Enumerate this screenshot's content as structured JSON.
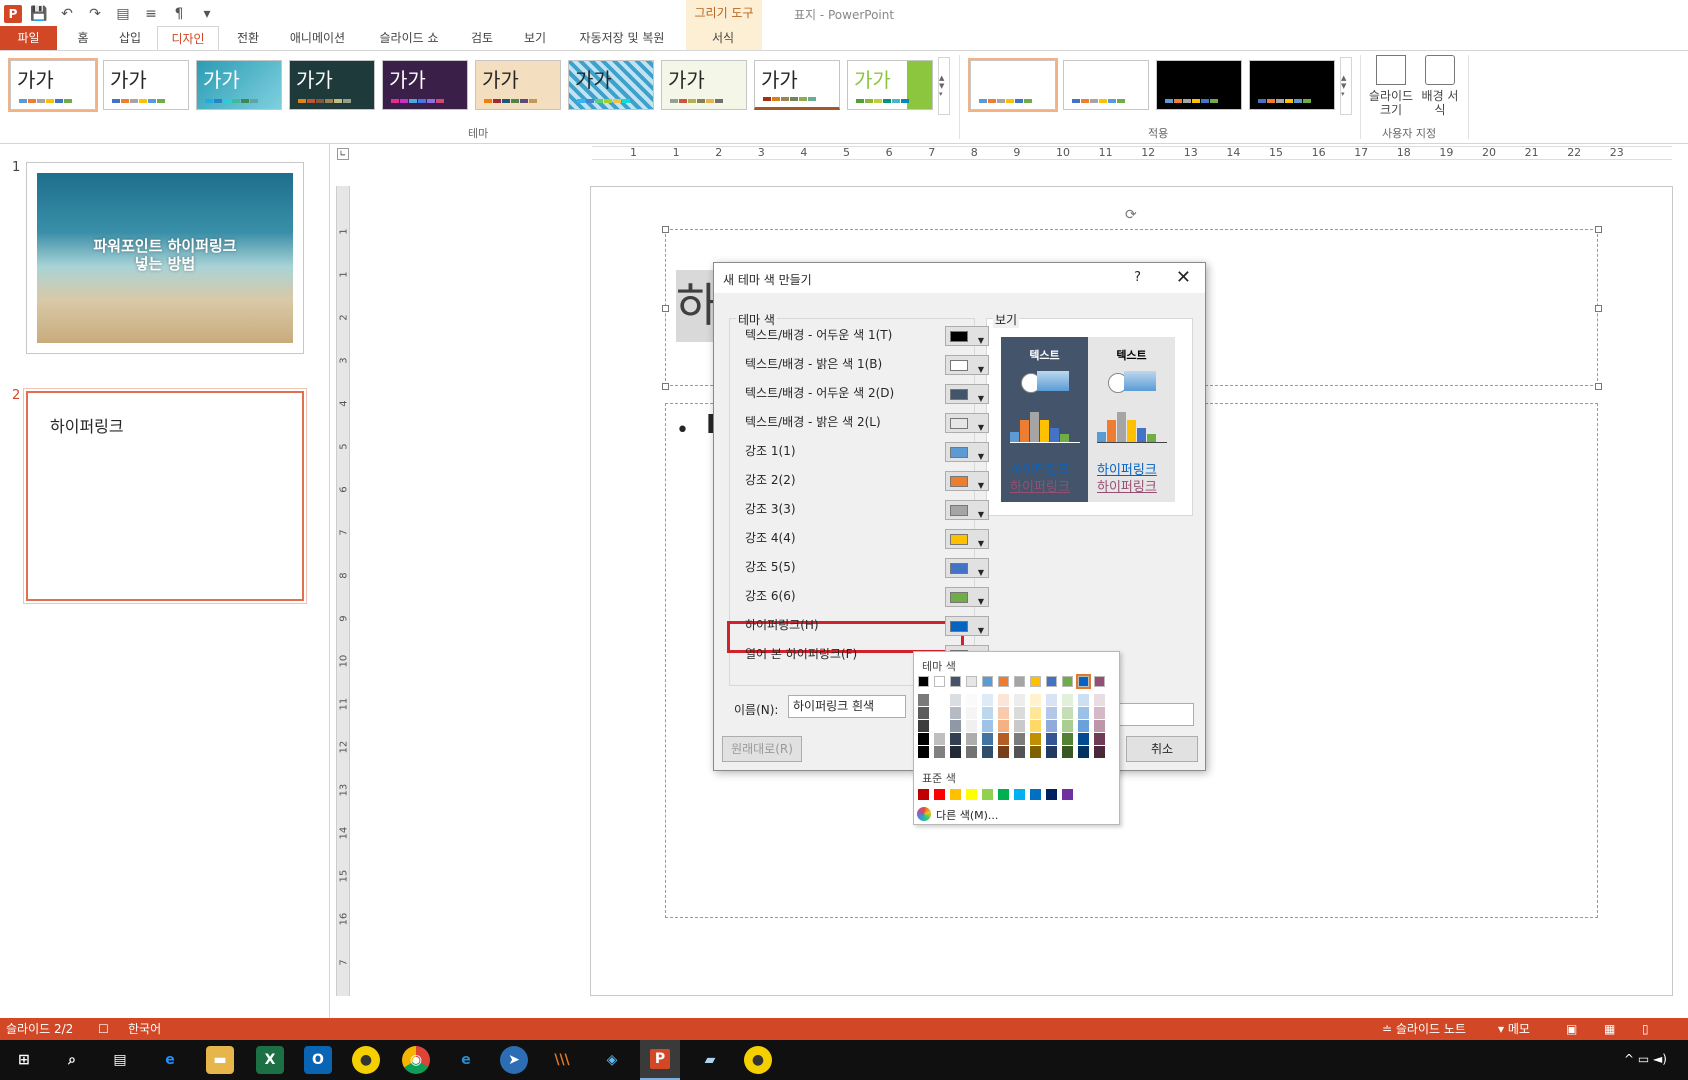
{
  "app": {
    "title": "표지 - PowerPoint",
    "contextual_group": "그리기 도구"
  },
  "qat": {
    "icons": [
      "powerpoint-logo",
      "save-icon",
      "undo-icon",
      "redo-icon",
      "start-from-beginning-icon",
      "align-icon",
      "paragraph-icon",
      "customize-qat-icon"
    ],
    "logo_letter": "P"
  },
  "tabs": [
    "파일",
    "홈",
    "삽입",
    "디자인",
    "전환",
    "애니메이션",
    "슬라이드 쇼",
    "검토",
    "보기",
    "자동저장 및 복원",
    "서식"
  ],
  "active_tab": "디자인",
  "ribbon": {
    "theme_sample_text": "가가",
    "themes_group_label": "테마",
    "variants_group_label": "적용",
    "customize_group_label": "사용자 지정",
    "slide_size_label": "슬라이드 크기",
    "background_label": "배경 서식"
  },
  "ruler": {
    "h_ticks": [
      "1",
      "1",
      "2",
      "3",
      "4",
      "5",
      "6",
      "7",
      "8",
      "9",
      "10",
      "11",
      "12",
      "13",
      "14",
      "15",
      "16",
      "17",
      "18",
      "19",
      "20",
      "21",
      "22",
      "23"
    ],
    "v_ticks": [
      "1",
      "1",
      "2",
      "3",
      "4",
      "5",
      "6",
      "7",
      "8",
      "9",
      "10",
      "11",
      "12",
      "13",
      "14",
      "15",
      "16",
      "7"
    ]
  },
  "slides_pane": {
    "slide1_number": "1",
    "slide1_title": "파워포인트 하이퍼링크\n넣는 방법",
    "slide2_number": "2",
    "slide2_title": "하이퍼링크"
  },
  "slide_canvas": {
    "title_glyph": "하",
    "bullet_glyph": "E"
  },
  "dialog": {
    "title": "새 테마 색 만들기",
    "help": "?",
    "theme_colors_legend": "테마 색",
    "preview_legend": "보기",
    "rows": [
      {
        "label": "텍스트/배경 - 어두운 색 1(T)",
        "color": "#000000"
      },
      {
        "label": "텍스트/배경 - 밝은 색 1(B)",
        "color": "#ffffff"
      },
      {
        "label": "텍스트/배경 - 어두운 색 2(D)",
        "color": "#44546a"
      },
      {
        "label": "텍스트/배경 - 밝은 색 2(L)",
        "color": "#e7e6e6"
      },
      {
        "label": "강조 1(1)",
        "color": "#5b9bd5"
      },
      {
        "label": "강조 2(2)",
        "color": "#ed7d31"
      },
      {
        "label": "강조 3(3)",
        "color": "#a5a5a5"
      },
      {
        "label": "강조 4(4)",
        "color": "#ffc000"
      },
      {
        "label": "강조 5(5)",
        "color": "#4472c4"
      },
      {
        "label": "강조 6(6)",
        "color": "#70ad47"
      },
      {
        "label": "하이퍼링크(H)",
        "color": "#0563c1"
      },
      {
        "label": "열어 본 하이퍼링크(F)",
        "color": "#954f72"
      }
    ],
    "preview_text": "텍스트",
    "preview_link": "하이퍼링크",
    "preview_visited": "하이퍼링크",
    "name_label": "이름(N):",
    "name_value": "하이퍼링크 흰색",
    "reset_button": "원래대로(R)",
    "cancel_button": "취소"
  },
  "color_popup": {
    "theme_header": "테마 색",
    "standard_header": "표준 색",
    "more_colors": "다른 색(M)...",
    "theme_row": [
      "#000000",
      "#ffffff",
      "#44546a",
      "#e7e6e6",
      "#5b9bd5",
      "#ed7d31",
      "#a5a5a5",
      "#ffc000",
      "#4472c4",
      "#70ad47",
      "#0563c1",
      "#954f72"
    ],
    "standard_row": [
      "#c00000",
      "#ff0000",
      "#ffc000",
      "#ffff00",
      "#92d050",
      "#00b050",
      "#00b0f0",
      "#0070c0",
      "#002060",
      "#7030a0"
    ]
  },
  "statusbar": {
    "slide_info": "슬라이드 2/2",
    "language": "한국어",
    "notes": "슬라이드 노트",
    "comments": "메모"
  },
  "taskbar": {
    "apps": [
      "start-icon",
      "search-icon",
      "task-view-icon",
      "edge-icon",
      "file-explorer-icon",
      "excel-icon",
      "outlook-icon",
      "kakaotalk-icon",
      "chrome-icon",
      "ie-icon",
      "app-icon",
      "winamp-icon",
      "box-icon",
      "powerpoint-icon",
      "note-icon",
      "kakaotalk2-icon"
    ]
  }
}
